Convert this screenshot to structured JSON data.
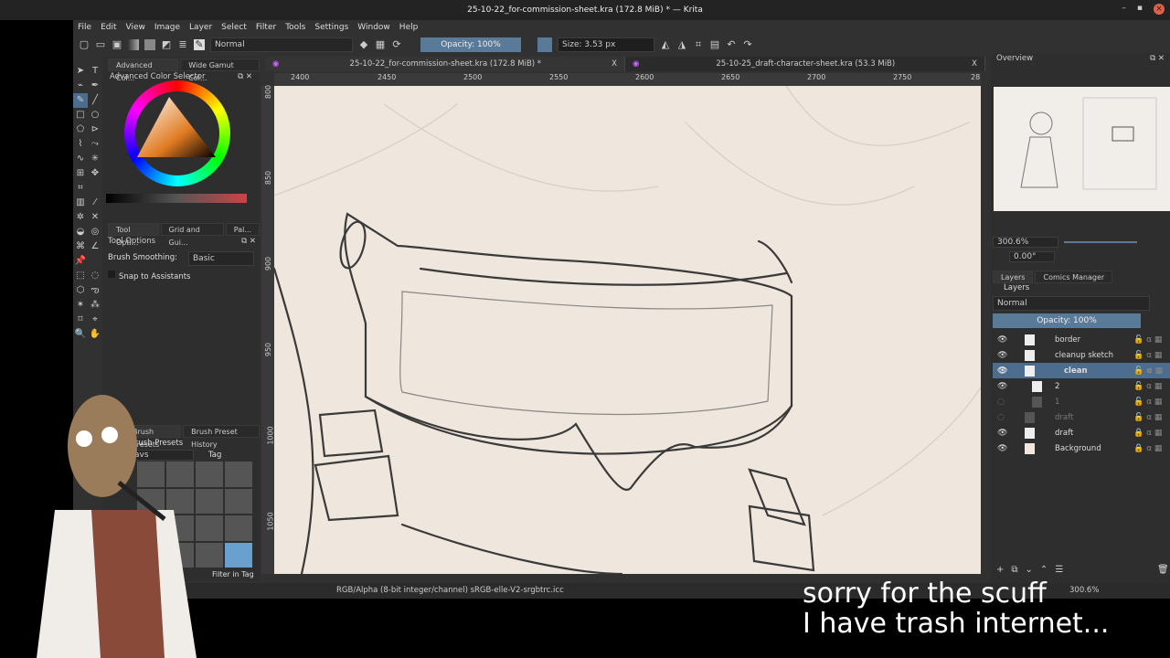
{
  "window": {
    "title": "25-10-22_for-commission-sheet.kra (172.8 MiB) * — Krita",
    "min": "–",
    "max": "▪",
    "close": "×"
  },
  "menu": [
    "File",
    "Edit",
    "View",
    "Image",
    "Layer",
    "Select",
    "Filter",
    "Tools",
    "Settings",
    "Window",
    "Help"
  ],
  "toolbar": {
    "blend_mode": "Normal",
    "opacity": "Opacity: 100%",
    "size": "Size: 3.53 px"
  },
  "left_dock": {
    "tabs": [
      "Advanced Col...",
      "Wide Gamut Col..."
    ],
    "color_selector_title": "Advanced Color Selector",
    "tool_tabs": [
      "Tool Opti...",
      "Grid and Gui...",
      "Pal..."
    ],
    "tool_options_title": "Tool Options",
    "brush_smoothing_label": "Brush Smoothing:",
    "brush_smoothing_value": "Basic",
    "snap_label": "Snap to Assistants",
    "preset_tabs": [
      "Brush Presets",
      "Brush Preset History"
    ],
    "presets_title": "Brush Presets",
    "preset_tag_filter": "avs",
    "tag_label": "Tag",
    "filter_in_tag": "Filter in Tag"
  },
  "canvas_tabs": [
    {
      "label": "25-10-22_for-commission-sheet.kra (172.8 MiB) *",
      "close": "X"
    },
    {
      "label": "25-10-25_draft-character-sheet.kra (53.3 MiB)",
      "close": "X"
    }
  ],
  "ruler_top": [
    "2400",
    "2450",
    "2500",
    "2550",
    "2600",
    "2650",
    "2700",
    "2750",
    "28"
  ],
  "ruler_left": [
    "800",
    "850",
    "900",
    "950",
    "1000",
    "1050"
  ],
  "overview": {
    "title": "Overview",
    "zoom": "300.6%",
    "rotation": "0.00°"
  },
  "layers_panel": {
    "tabs": [
      "Layers",
      "Comics Manager"
    ],
    "title": "Layers",
    "blend": "Normal",
    "opacity": "Opacity:  100%",
    "layers": [
      {
        "name": "border",
        "visible": true
      },
      {
        "name": "cleanup sketch",
        "visible": true
      },
      {
        "name": "clean",
        "visible": true,
        "selected": true
      },
      {
        "name": "2",
        "visible": true
      },
      {
        "name": "1",
        "visible": false
      },
      {
        "name": "draft",
        "visible": false
      },
      {
        "name": "draft",
        "visible": true
      },
      {
        "name": "Background",
        "visible": true
      }
    ]
  },
  "statusbar": {
    "color_space": "RGB/Alpha (8-bit integer/channel)  sRGB-elle-V2-srgbtrc.icc",
    "zoom": "300.6%"
  },
  "subtitle": {
    "line1": "sorry for the scuff",
    "line2": "I have trash internet..."
  }
}
